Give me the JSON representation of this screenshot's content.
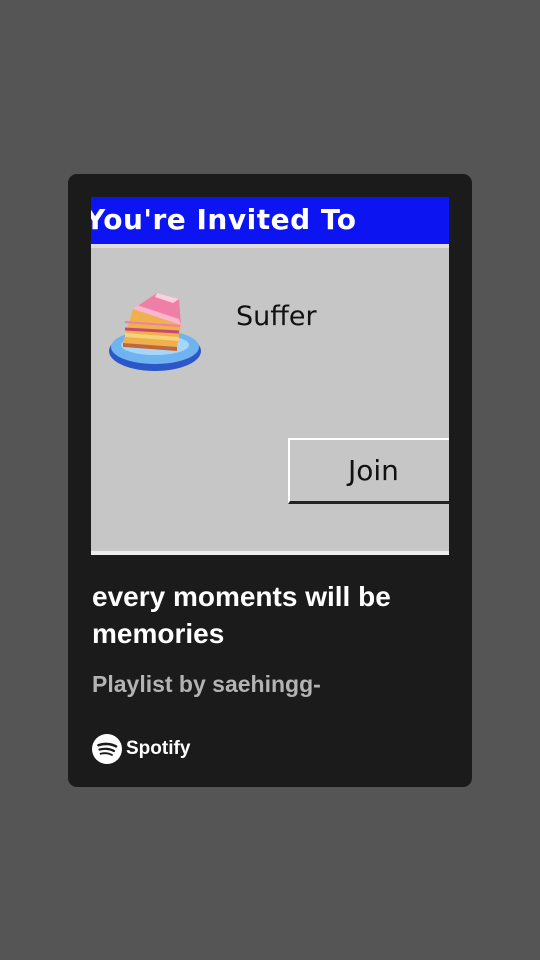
{
  "card": {
    "artwork": {
      "window_title": "You're Invited To",
      "message": "Suffer",
      "button_label": "Join",
      "icon": "cake-icon"
    },
    "title": "every moments will be memories",
    "subtitle": "Playlist by saehingg-",
    "brand": {
      "name": "Spotify",
      "icon": "spotify-icon"
    }
  },
  "colors": {
    "page_background": "#555555",
    "card_background": "#1b1b1b",
    "titlebar": "#0c14f2",
    "dialog_background": "#c6c6c6",
    "subtitle": "#b3b3b3"
  }
}
